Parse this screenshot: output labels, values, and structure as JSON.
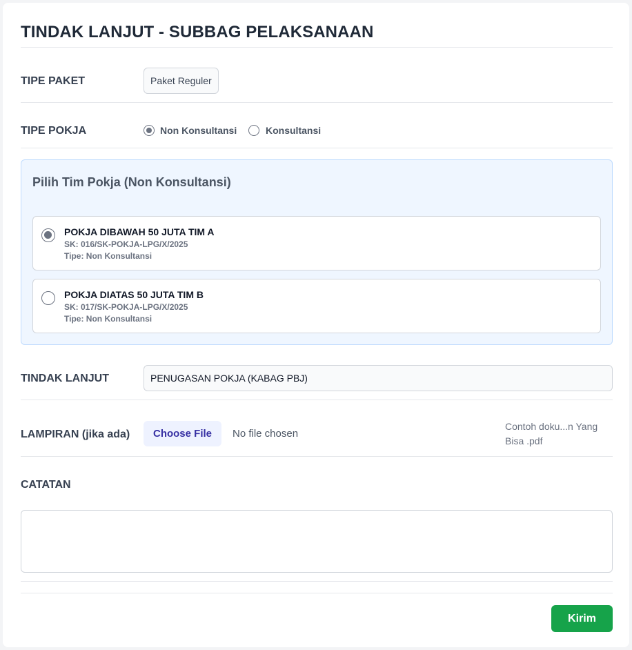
{
  "page": {
    "title": "TINDAK LANJUT - SUBBAG PELAKSANAAN"
  },
  "tipe_paket": {
    "label": "TIPE PAKET",
    "value": "Paket Reguler"
  },
  "tipe_pokja": {
    "label": "TIPE POKJA",
    "options": [
      {
        "label": "Non Konsultansi",
        "checked": true
      },
      {
        "label": "Konsultansi",
        "checked": false
      }
    ]
  },
  "tim_pokja": {
    "title": "Pilih Tim Pokja (Non Konsultansi)",
    "options": [
      {
        "name": "POKJA DIBAWAH 50 JUTA TIM A",
        "sk": "SK: 016/SK-POKJA-LPG/X/2025",
        "tipe": "Tipe: Non Konsultansi",
        "checked": true
      },
      {
        "name": "POKJA DIATAS 50 JUTA TIM B",
        "sk": "SK: 017/SK-POKJA-LPG/X/2025",
        "tipe": "Tipe: Non Konsultansi",
        "checked": false
      }
    ]
  },
  "tindak_lanjut": {
    "label": "TINDAK LANJUT",
    "value": "PENUGASAN POKJA (KABAG PBJ)"
  },
  "lampiran": {
    "label": "LAMPIRAN (jika ada)",
    "button_label": "Choose File",
    "status": "No file chosen",
    "hint": "Contoh doku...n Yang Bisa .pdf"
  },
  "catatan": {
    "label": "CATATAN",
    "value": ""
  },
  "submit": {
    "label": "Kirim"
  },
  "colors": {
    "submit": "#16a34a",
    "panel_bg": "#eff6ff",
    "file_button_text": "#3730a3"
  }
}
